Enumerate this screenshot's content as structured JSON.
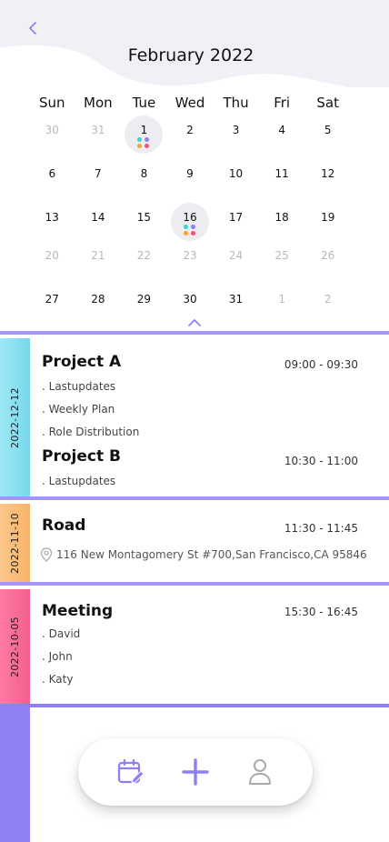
{
  "header": {
    "month_title": "February 2022",
    "back_icon": "chevron-left-icon",
    "collapse_icon": "chevron-up-icon"
  },
  "calendar": {
    "weekdays": [
      "Sun",
      "Mon",
      "Tue",
      "Wed",
      "Thu",
      "Fri",
      "Sat"
    ],
    "weeks": [
      [
        {
          "d": "30",
          "muted": true
        },
        {
          "d": "31",
          "muted": true
        },
        {
          "d": "1",
          "selected": true,
          "dots": true
        },
        {
          "d": "2"
        },
        {
          "d": "3"
        },
        {
          "d": "4"
        },
        {
          "d": "5"
        }
      ],
      [
        {
          "d": "6"
        },
        {
          "d": "7"
        },
        {
          "d": "8"
        },
        {
          "d": "9"
        },
        {
          "d": "10"
        },
        {
          "d": "11"
        },
        {
          "d": "12"
        }
      ],
      [
        {
          "d": "13"
        },
        {
          "d": "14"
        },
        {
          "d": "15"
        },
        {
          "d": "16",
          "selected": true,
          "dots": true
        },
        {
          "d": "17"
        },
        {
          "d": "18"
        },
        {
          "d": "19"
        }
      ],
      [
        {
          "d": "20",
          "muted": true
        },
        {
          "d": "21",
          "muted": true
        },
        {
          "d": "22",
          "muted": true
        },
        {
          "d": "23",
          "muted": true
        },
        {
          "d": "24",
          "muted": true
        },
        {
          "d": "25",
          "muted": true
        },
        {
          "d": "26",
          "muted": true
        }
      ],
      [
        {
          "d": "27"
        },
        {
          "d": "28"
        },
        {
          "d": "29"
        },
        {
          "d": "30"
        },
        {
          "d": "31"
        },
        {
          "d": "1",
          "muted": true
        },
        {
          "d": "2",
          "muted": true
        }
      ]
    ],
    "dot_colors": [
      "#3fd0c9",
      "#8d7ff4",
      "#f5a623",
      "#f2557a"
    ]
  },
  "events": {
    "card1": {
      "date": "2022-12-12",
      "tab_gradient": [
        "#9ee8f6",
        "#78d8ea"
      ],
      "project_a": {
        "title": "Project A",
        "time": "09:00 - 09:30",
        "items": [
          ". Lastupdates",
          ". Weekly Plan",
          ". Role Distribution"
        ]
      },
      "project_b": {
        "title": "Project B",
        "time": "10:30 - 11:00",
        "items": [
          ". Lastupdates"
        ]
      }
    },
    "card2": {
      "date": "2022-11-10",
      "tab_gradient": [
        "#fbc78a",
        "#f8b26a"
      ],
      "title": "Road",
      "time": "11:30 - 11:45",
      "location_icon": "location-pin-icon",
      "address": "116 New Montagomery St #700,San Francisco,CA 95846"
    },
    "card3": {
      "date": "2022-10-05",
      "tab_gradient": [
        "#ff7ba3",
        "#f0608a"
      ],
      "title": "Meeting",
      "time": "15:30 - 16:45",
      "items": [
        ". David",
        ". John",
        ". Katy"
      ]
    }
  },
  "bottom_nav": {
    "items": [
      {
        "icon": "calendar-edit-icon",
        "active": true
      },
      {
        "icon": "plus-icon",
        "active": true
      },
      {
        "icon": "user-icon",
        "active": false
      }
    ]
  },
  "colors": {
    "accent": "#8d7ff4",
    "header_bg": "#f1f0f6",
    "muted_icon": "#a8a8ae"
  }
}
